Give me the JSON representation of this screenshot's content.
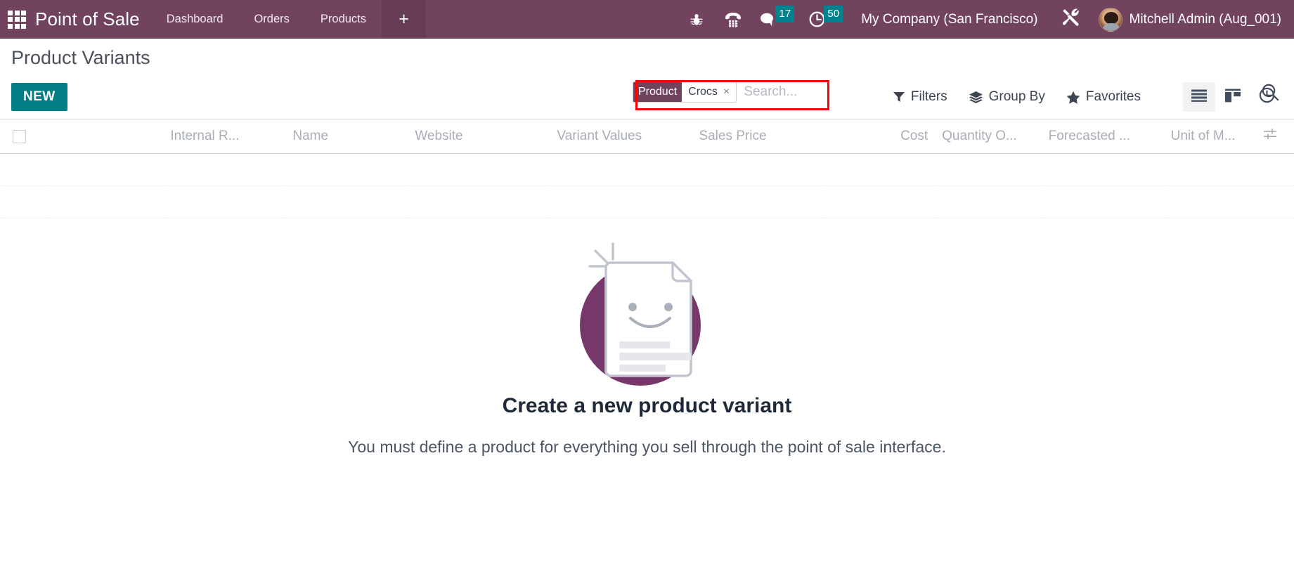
{
  "navbar": {
    "apps_icon": "apps-grid-icon",
    "brand": "Point of Sale",
    "menu_items": [
      {
        "label": "Dashboard"
      },
      {
        "label": "Orders"
      },
      {
        "label": "Products"
      }
    ],
    "plus_label": "+",
    "sys_icons": [
      {
        "name": "bug-icon",
        "badge": null
      },
      {
        "name": "phone-dialpad-icon",
        "badge": null
      },
      {
        "name": "messages-icon",
        "badge": "17"
      },
      {
        "name": "activities-clock-icon",
        "badge": "50"
      }
    ],
    "company": "My Company (San Francisco)",
    "tools_icon": "tools-wrench-icon",
    "user": "Mitchell Admin (Aug_001)"
  },
  "control_panel": {
    "page_title": "Product Variants",
    "new_label": "NEW",
    "search": {
      "facet_label": "Product",
      "facet_value": "Crocs",
      "facet_remove": "×",
      "placeholder": "Search...",
      "value": "",
      "magnifier_icon": "search-icon"
    },
    "dropdowns": [
      {
        "label": "Filters",
        "icon": "filter-funnel-icon"
      },
      {
        "label": "Group By",
        "icon": "layers-icon"
      },
      {
        "label": "Favorites",
        "icon": "star-icon"
      }
    ],
    "views": [
      {
        "name": "list-view",
        "icon": "list-icon",
        "active": true
      },
      {
        "name": "kanban-view",
        "icon": "kanban-icon",
        "active": false
      },
      {
        "name": "activity-view",
        "icon": "clock-icon",
        "active": false
      }
    ]
  },
  "list": {
    "columns": [
      {
        "label": "Internal R...",
        "align": "left"
      },
      {
        "label": "Name",
        "align": "left"
      },
      {
        "label": "Website",
        "align": "left"
      },
      {
        "label": "Variant Values",
        "align": "left"
      },
      {
        "label": "Sales Price",
        "align": "left"
      },
      {
        "label": "Cost",
        "align": "right"
      },
      {
        "label": "Quantity O...",
        "align": "left"
      },
      {
        "label": "Forecasted ...",
        "align": "left"
      },
      {
        "label": "Unit of M...",
        "align": "left"
      }
    ],
    "optional_columns_icon": "sliders-icon",
    "rows": []
  },
  "nocontent": {
    "title": "Create a new product variant",
    "subtitle": "You must define a product for everything you sell through the point of sale interface.",
    "illustration": "smiling-document-icon"
  },
  "colors": {
    "brand_purple": "#71435f",
    "accent_teal": "#017e84",
    "badge_teal": "#00838f",
    "highlight_red": "#ff0000",
    "illustration_purple": "#78376b"
  }
}
